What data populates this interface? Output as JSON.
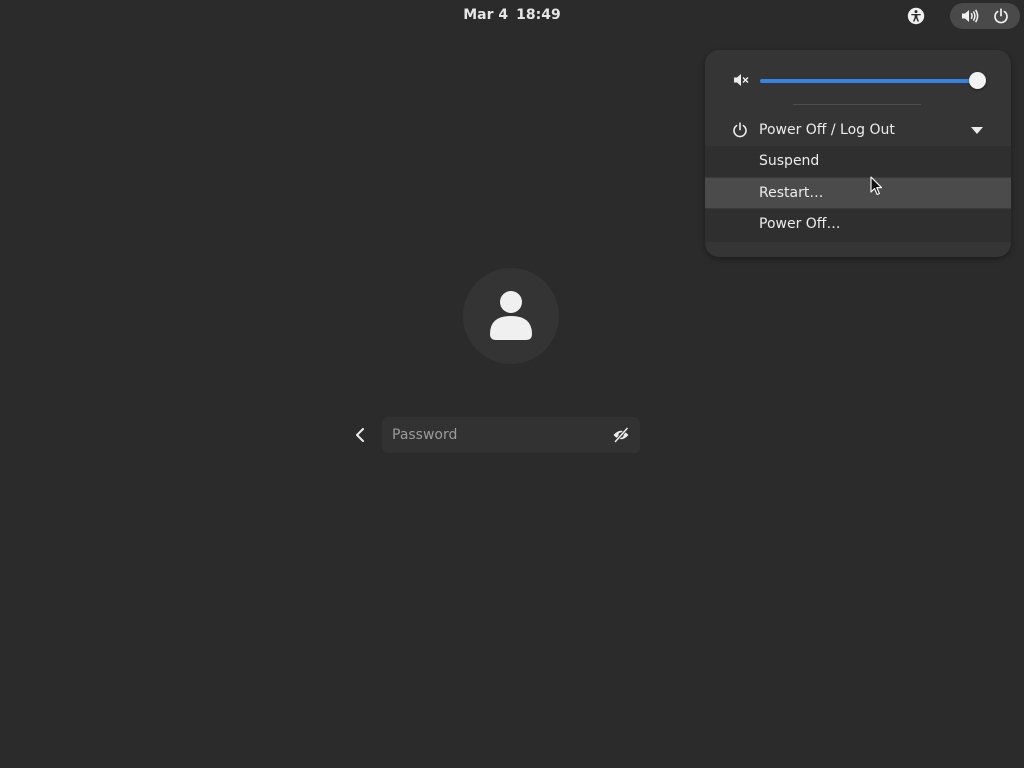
{
  "top_bar": {
    "clock": {
      "date": "Mar 4",
      "time": "18:49"
    },
    "icons": {
      "accessibility": "accessibility-icon",
      "volume": "speaker-volume-icon",
      "power": "power-icon"
    }
  },
  "quick_settings": {
    "volume": {
      "icon": "speaker-muted-icon",
      "level_percent": 100
    },
    "power_menu": {
      "label": "Power Off / Log Out",
      "expanded": true,
      "items": [
        {
          "label": "Suspend",
          "hovered": false
        },
        {
          "label": "Restart…",
          "hovered": true
        },
        {
          "label": "Power Off…",
          "hovered": false
        }
      ]
    }
  },
  "login": {
    "avatar_icon": "user-avatar-icon",
    "back_icon": "chevron-left-icon",
    "password": {
      "value": "",
      "placeholder": "Password"
    },
    "reveal_icon": "eye-hidden-icon"
  },
  "colors": {
    "background": "#2b2b2b",
    "menu_background": "#353535",
    "accent": "#3584e4",
    "hover": "#4b4b4b",
    "text": "#ececec"
  }
}
